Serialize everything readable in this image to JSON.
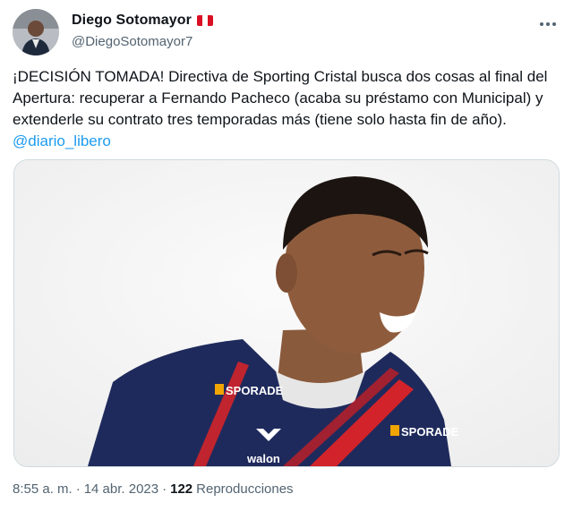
{
  "author": {
    "display_name": "Diego Sotomayor",
    "handle": "@DiegoSotomayor7",
    "flag_colors": [
      "#d91023",
      "#ffffff",
      "#d91023"
    ]
  },
  "tweet": {
    "text": "¡DECISIÓN TOMADA! Directiva de Sporting Cristal busca dos cosas al final del Apertura: recuperar a Fernando Pacheco (acaba su préstamo con Municipal) y extenderle su contrato tres temporadas más (tiene solo hasta fin de año). ",
    "mention": "@diario_libero"
  },
  "media": {
    "jersey_texts": [
      "SPORADE",
      "SPORADE",
      "walon"
    ]
  },
  "meta": {
    "time": "8:55 a. m.",
    "separator": "·",
    "date": "14 abr. 2023",
    "views_count": "122",
    "views_label": "Reproducciones"
  },
  "colors": {
    "link": "#1d9bf0",
    "secondary_text": "#536471",
    "jersey_navy": "#1f2a5c",
    "jersey_red": "#d2232a"
  },
  "icons": {
    "more": "more-dots-icon",
    "flag": "peru-flag-icon"
  }
}
